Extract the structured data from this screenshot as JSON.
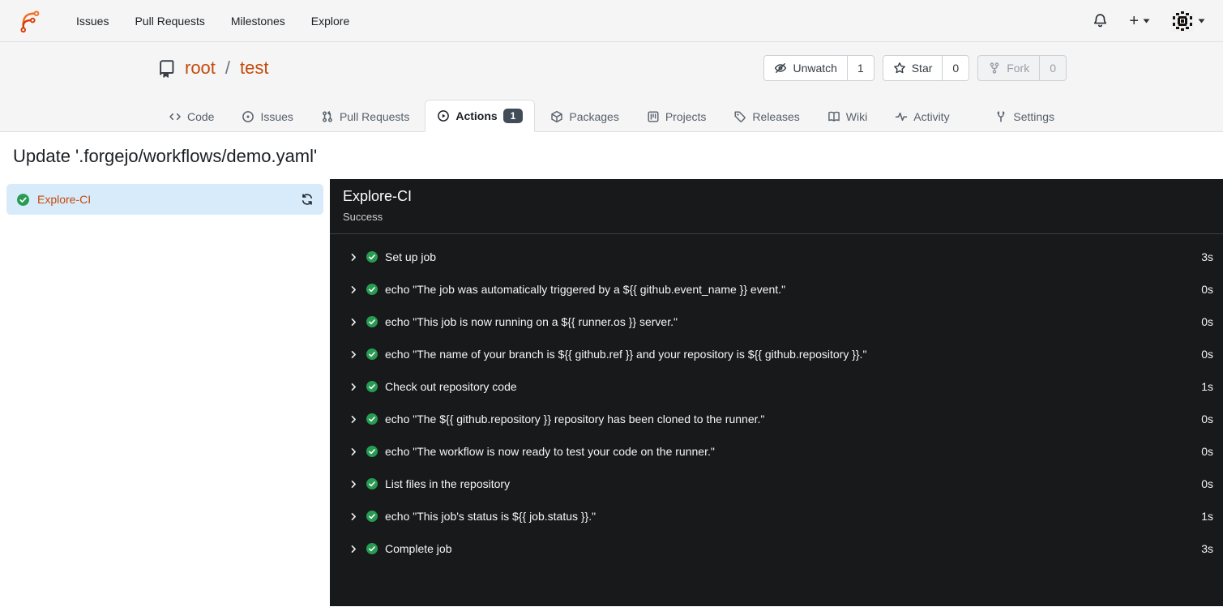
{
  "navbar": {
    "links": [
      "Issues",
      "Pull Requests",
      "Milestones",
      "Explore"
    ]
  },
  "repo": {
    "owner": "root",
    "separator": "/",
    "name": "test",
    "buttons": {
      "unwatch": {
        "label": "Unwatch",
        "count": "1"
      },
      "star": {
        "label": "Star",
        "count": "0"
      },
      "fork": {
        "label": "Fork",
        "count": "0",
        "disabled": true
      }
    },
    "tabs": {
      "code": {
        "label": "Code"
      },
      "issues": {
        "label": "Issues"
      },
      "pull_requests": {
        "label": "Pull Requests"
      },
      "actions": {
        "label": "Actions",
        "badge": "1"
      },
      "packages": {
        "label": "Packages"
      },
      "projects": {
        "label": "Projects"
      },
      "releases": {
        "label": "Releases"
      },
      "wiki": {
        "label": "Wiki"
      },
      "activity": {
        "label": "Activity"
      },
      "settings": {
        "label": "Settings"
      }
    }
  },
  "run": {
    "title": "Update '.forgejo/workflows/demo.yaml'",
    "jobs": [
      {
        "name": "Explore-CI",
        "status": "success"
      }
    ],
    "panel": {
      "job_name": "Explore-CI",
      "status_text": "Success"
    },
    "steps": [
      {
        "name": "Set up job",
        "duration": "3s"
      },
      {
        "name": "echo \"The job was automatically triggered by a ${{ github.event_name }} event.\"",
        "duration": "0s"
      },
      {
        "name": "echo \"This job is now running on a ${{ runner.os }} server.\"",
        "duration": "0s"
      },
      {
        "name": "echo \"The name of your branch is ${{ github.ref }} and your repository is ${{ github.repository }}.\"",
        "duration": "0s"
      },
      {
        "name": "Check out repository code",
        "duration": "1s"
      },
      {
        "name": "echo \"The ${{ github.repository }} repository has been cloned to the runner.\"",
        "duration": "0s"
      },
      {
        "name": "echo \"The workflow is now ready to test your code on the runner.\"",
        "duration": "0s"
      },
      {
        "name": "List files in the repository",
        "duration": "0s"
      },
      {
        "name": "echo \"This job's status is ${{ job.status }}.\"",
        "duration": "1s"
      },
      {
        "name": "Complete job",
        "duration": "3s"
      }
    ]
  },
  "colors": {
    "accent": "#c44b0c",
    "success": "#279b51",
    "panel_bg": "#17191b",
    "sidebar_selected": "#d8ebfa",
    "badge_bg": "#414c58",
    "chrome_bg": "#f5f5f6"
  }
}
